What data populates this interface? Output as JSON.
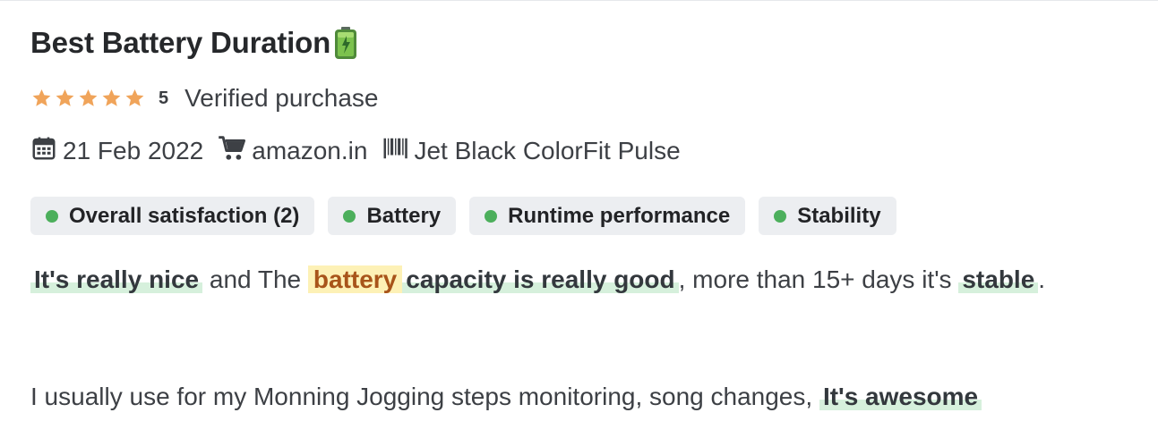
{
  "review": {
    "title": "Best Battery Duration",
    "title_icon": "battery-icon",
    "rating_value": "5",
    "rating_stars": 5,
    "star_color": "#f0a45a",
    "verified_label": "Verified purchase",
    "date": "21 Feb 2022",
    "store": "amazon.in",
    "product_variant": "Jet Black ColorFit Pulse",
    "aspects": [
      {
        "label": "Overall satisfaction (2)",
        "dot_color": "#4caf5c"
      },
      {
        "label": "Battery",
        "dot_color": "#4caf5c"
      },
      {
        "label": "Runtime performance",
        "dot_color": "#4caf5c"
      },
      {
        "label": "Stability",
        "dot_color": "#4caf5c"
      }
    ],
    "body": {
      "line1": {
        "p1": "It's really nice",
        "p2": " and The ",
        "p3": "battery",
        "p4": "capacity is really good",
        "p5": ", more than 15+ days it's ",
        "p6": "stable",
        "p7": "."
      },
      "line2": {
        "p1": "I usually use for my Monning Jogging steps monitoring, song changes, ",
        "p2": "It's awesome"
      }
    },
    "highlight_color": "#d6f0dc",
    "keyword_highlight_color": "#fdf1b6"
  }
}
